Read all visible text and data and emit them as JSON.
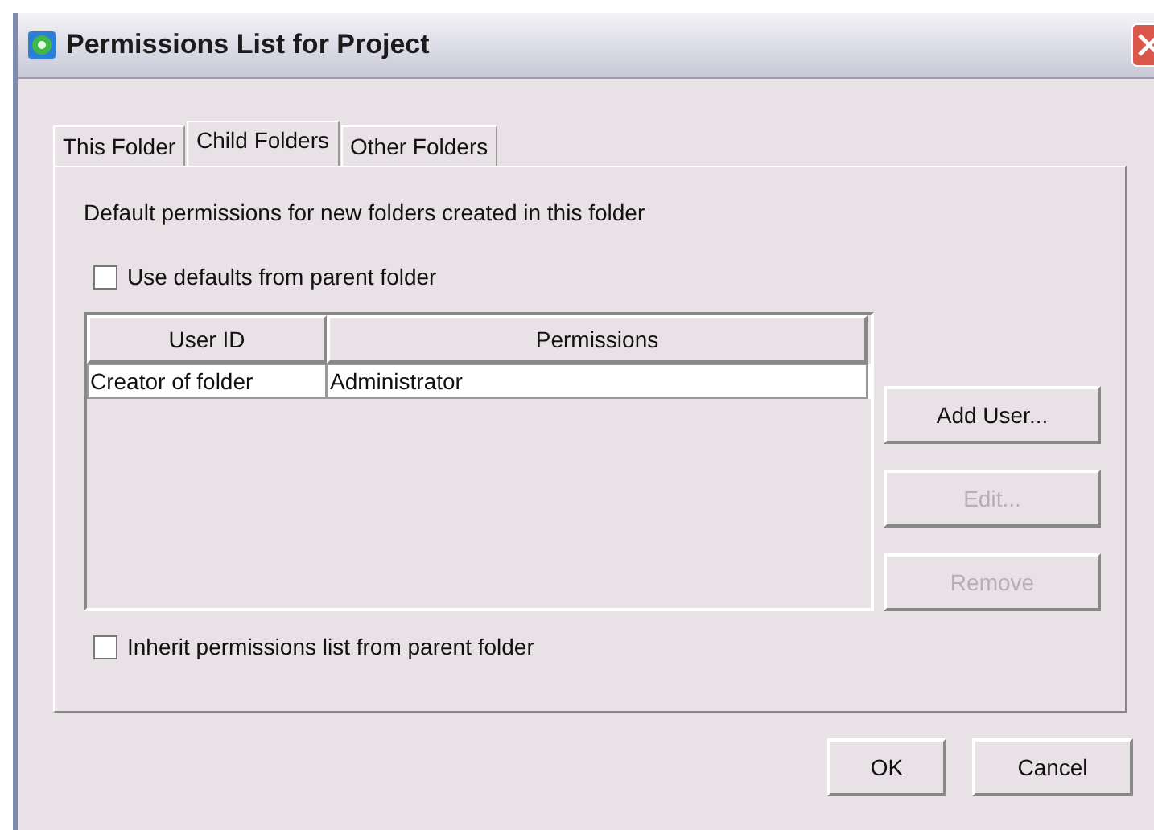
{
  "window": {
    "title": "Permissions List for Project"
  },
  "tabs": [
    {
      "label": "This Folder",
      "selected": false
    },
    {
      "label": "Child Folders",
      "selected": true
    },
    {
      "label": "Other Folders",
      "selected": false
    }
  ],
  "description": "Default permissions for new folders created in this folder",
  "use_defaults": {
    "label": "Use defaults from parent folder",
    "checked": false
  },
  "table": {
    "columns": [
      "User ID",
      "Permissions"
    ],
    "rows": [
      [
        "Creator of folder",
        "Administrator"
      ]
    ]
  },
  "side_buttons": [
    {
      "label": "Add User...",
      "disabled": false
    },
    {
      "label": "Edit...",
      "disabled": true
    },
    {
      "label": "Remove",
      "disabled": true
    }
  ],
  "inherit": {
    "label": "Inherit permissions list from parent folder",
    "checked": false
  },
  "buttons": [
    "OK",
    "Cancel"
  ]
}
